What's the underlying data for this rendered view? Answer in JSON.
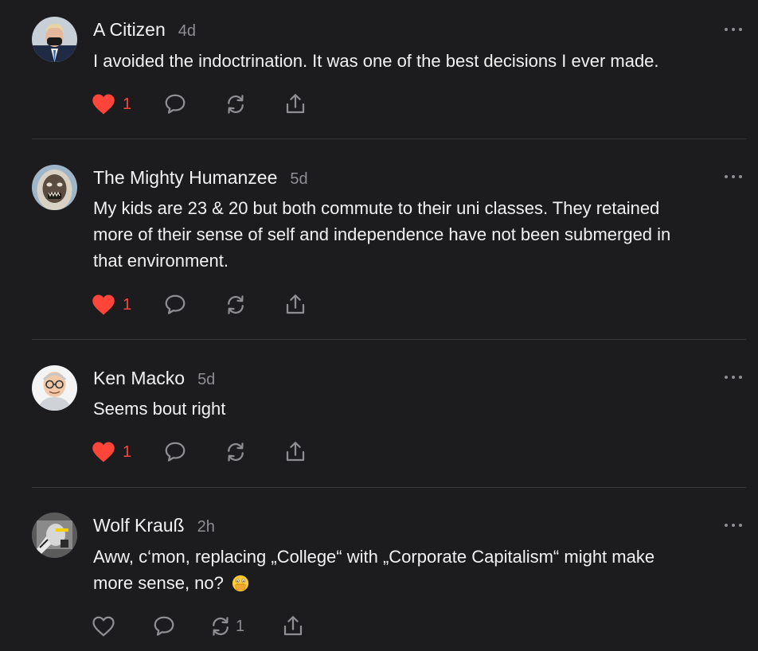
{
  "posts": [
    {
      "author": "A Citizen",
      "time": "4d",
      "text": "I avoided the indoctrination. It was one of the best decisions I ever made.",
      "likes": "1",
      "liked": true,
      "restacks": ""
    },
    {
      "author": "The Mighty Humanzee",
      "time": "5d",
      "text_lines": [
        "My kids are 23 & 20 but both commute to their uni classes. They retained",
        "more of their sense of self and independence have not been submerged in",
        "that environment."
      ],
      "likes": "1",
      "liked": true,
      "restacks": ""
    },
    {
      "author": "Ken Macko",
      "time": "5d",
      "text": "Seems bout right",
      "likes": "1",
      "liked": true,
      "restacks": ""
    },
    {
      "author": "Wolf Krauß",
      "time": "2h",
      "text_lines": [
        "Aww, c‘mon, replacing „College“ with „Corporate Capitalism“ might make",
        "more sense, no?"
      ],
      "emoji": "face-with-hand-over-mouth-emoji",
      "likes": "",
      "liked": false,
      "restacks": "1"
    }
  ],
  "colors": {
    "background": "#1c1c1e",
    "text": "#f2f2f2",
    "muted": "#8e8e93",
    "like": "#ff453a",
    "divider": "#38383a"
  }
}
